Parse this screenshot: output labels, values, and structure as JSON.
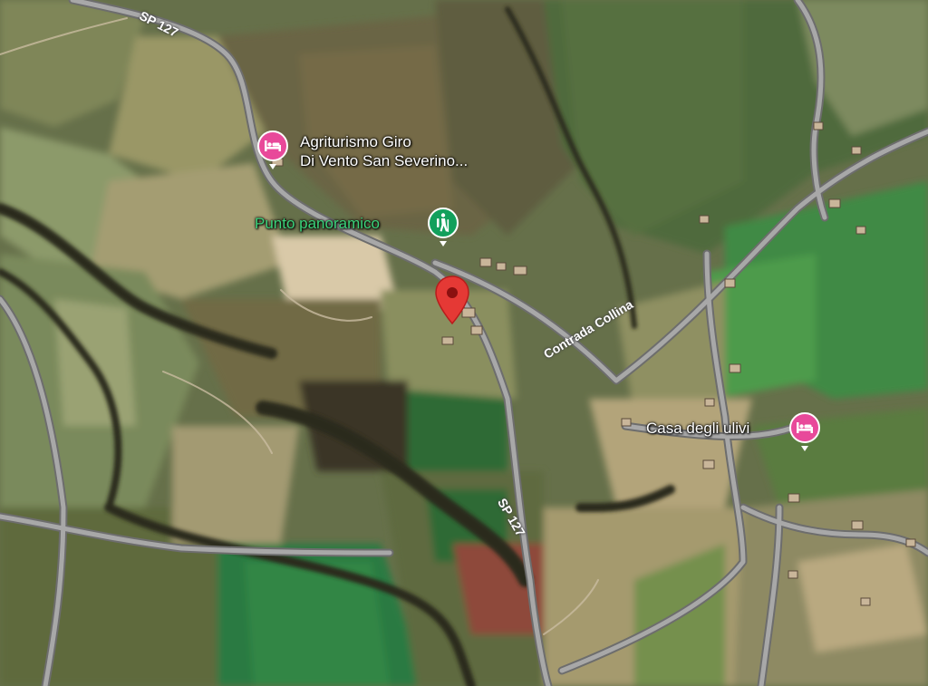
{
  "map": {
    "view": "satellite",
    "pois": [
      {
        "name": "Agriturismo Giro",
        "name_line2": "Di Vento San Severino...",
        "icon": "bed-icon",
        "color": "#e8499a"
      },
      {
        "name": "Punto panoramico",
        "icon": "hiking-icon",
        "color": "#12a05c"
      },
      {
        "name": "Casa degli ulivi",
        "icon": "bed-icon",
        "color": "#e8499a"
      }
    ],
    "roads": {
      "sp127_top": "SP 127",
      "sp127_bottom": "SP 127",
      "contrada": "Contrada Collina"
    },
    "marker": {
      "icon": "location-pin-icon",
      "color": "#e53935"
    }
  }
}
